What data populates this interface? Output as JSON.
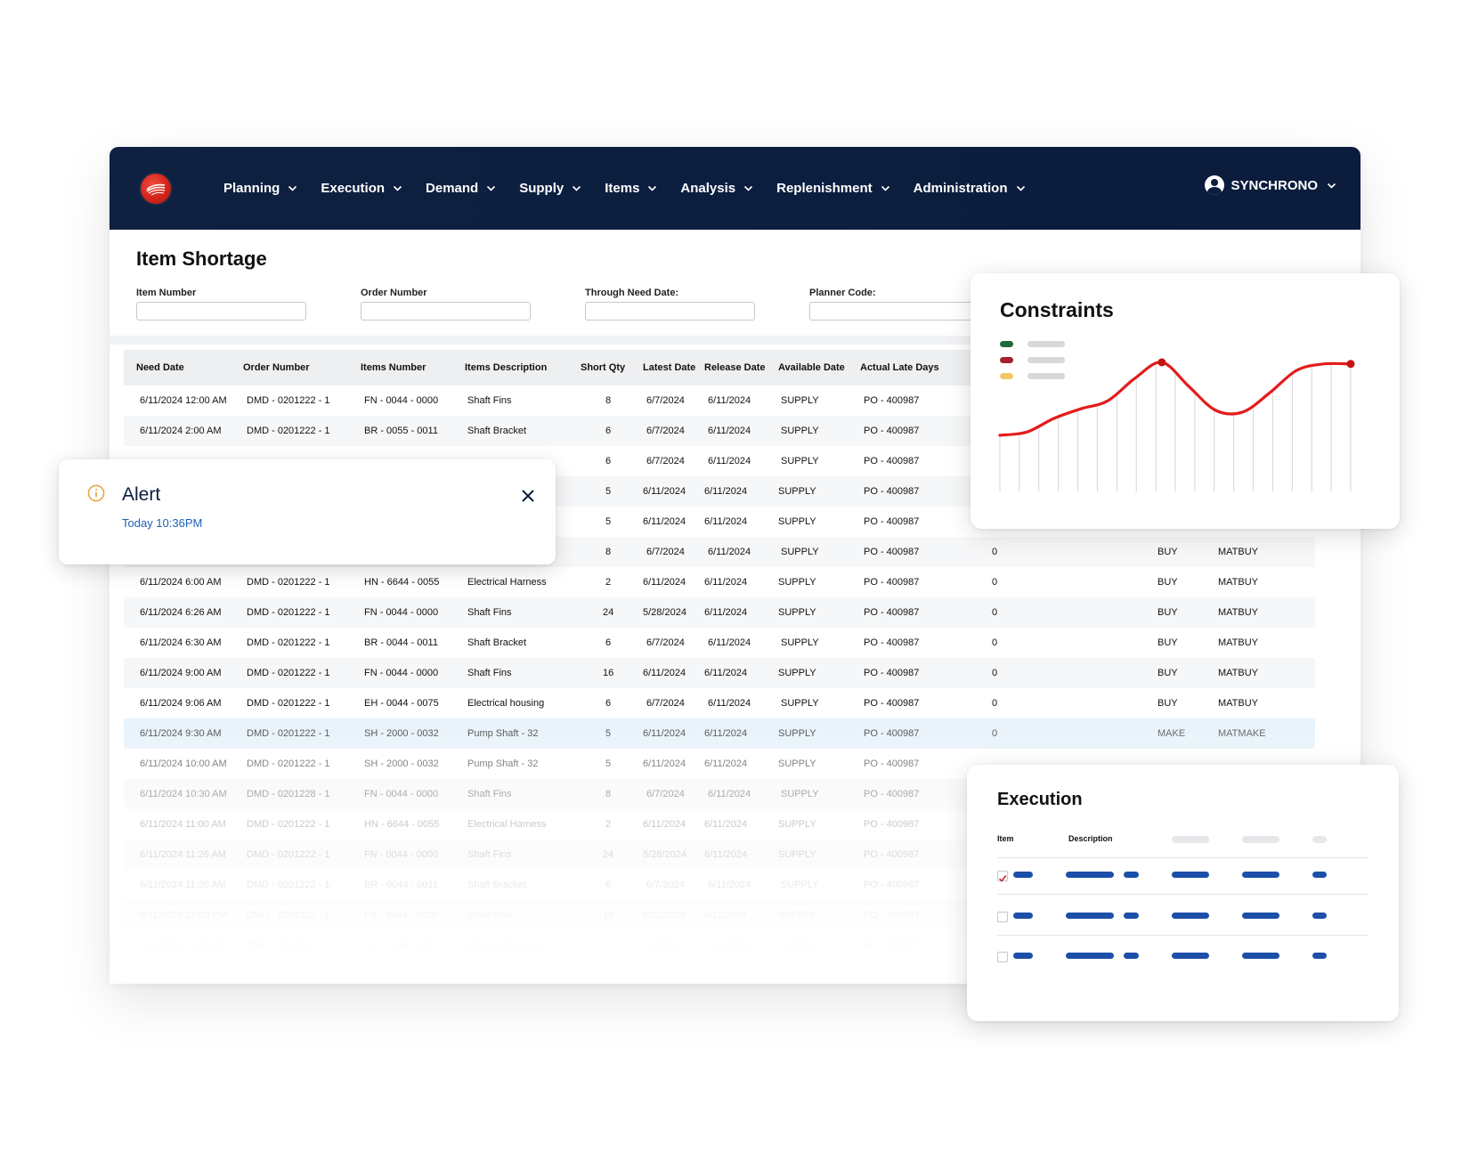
{
  "nav": {
    "items": [
      {
        "label": "Planning"
      },
      {
        "label": "Execution"
      },
      {
        "label": "Demand"
      },
      {
        "label": "Supply"
      },
      {
        "label": "Items"
      },
      {
        "label": "Analysis"
      },
      {
        "label": "Replenishment"
      },
      {
        "label": "Administration"
      }
    ],
    "user": "SYNCHRONO"
  },
  "page": {
    "title": "Item Shortage",
    "filters": [
      {
        "label": "Item Number",
        "value": ""
      },
      {
        "label": "Order Number",
        "value": ""
      },
      {
        "label": "Through Need Date:",
        "value": ""
      },
      {
        "label": "Planner Code:",
        "value": ""
      }
    ]
  },
  "table": {
    "columns": [
      "Need Date",
      "Order Number",
      "Items Number",
      "Items Description",
      "Short Qty",
      "Latest Date",
      "Release Date",
      "Available Date",
      "Actual Late Days"
    ],
    "rows": [
      [
        "6/11/2024 12:00 AM",
        "DMD - 0201222 - 1",
        "FN - 0044 - 0000",
        "Shaft Fins",
        "8",
        "6/7/2024",
        "6/11/2024",
        "SUPPLY",
        "PO - 400987",
        "",
        "",
        ""
      ],
      [
        "6/11/2024 2:00 AM",
        "DMD - 0201222 - 1",
        "BR - 0055 - 0011",
        "Shaft Bracket",
        "6",
        "6/7/2024",
        "6/11/2024",
        "SUPPLY",
        "PO - 400987",
        "",
        "",
        ""
      ],
      [
        "",
        "",
        "",
        "",
        "6",
        "6/7/2024",
        "6/11/2024",
        "SUPPLY",
        "PO - 400987",
        "",
        "",
        ""
      ],
      [
        "",
        "",
        "",
        "",
        "5",
        "6/11/2024",
        "6/11/2024",
        "SUPPLY",
        "PO - 400987",
        "",
        "",
        ""
      ],
      [
        "",
        "",
        "",
        "",
        "5",
        "6/11/2024",
        "6/11/2024",
        "SUPPLY",
        "PO - 400987",
        "",
        "",
        ""
      ],
      [
        "",
        "",
        "",
        "",
        "8",
        "6/7/2024",
        "6/11/2024",
        "SUPPLY",
        "PO - 400987",
        "0",
        "BUY",
        "MATBUY"
      ],
      [
        "6/11/2024 6:00 AM",
        "DMD - 0201222 - 1",
        "HN - 6644 - 0055",
        "Electrical Harness",
        "2",
        "6/11/2024",
        "6/11/2024",
        "SUPPLY",
        "PO - 400987",
        "0",
        "BUY",
        "MATBUY"
      ],
      [
        "6/11/2024 6:26 AM",
        "DMD - 0201222 - 1",
        "FN - 0044 - 0000",
        "Shaft Fins",
        "24",
        "5/28/2024",
        "6/11/2024",
        "SUPPLY",
        "PO - 400987",
        "0",
        "BUY",
        "MATBUY"
      ],
      [
        "6/11/2024 6:30 AM",
        "DMD - 0201222 - 1",
        "BR - 0044 - 0011",
        "Shaft Bracket",
        "6",
        "6/7/2024",
        "6/11/2024",
        "SUPPLY",
        "PO - 400987",
        "0",
        "BUY",
        "MATBUY"
      ],
      [
        "6/11/2024 9:00 AM",
        "DMD - 0201222 - 1",
        "FN - 0044 - 0000",
        "Shaft Fins",
        "16",
        "6/11/2024",
        "6/11/2024",
        "SUPPLY",
        "PO - 400987",
        "0",
        "BUY",
        "MATBUY"
      ],
      [
        "6/11/2024 9:06 AM",
        "DMD - 0201222 - 1",
        "EH - 0044 - 0075",
        "Electrical housing",
        "6",
        "6/7/2024",
        "6/11/2024",
        "SUPPLY",
        "PO - 400987",
        "0",
        "BUY",
        "MATBUY"
      ],
      [
        "6/11/2024 9:30 AM",
        "DMD - 0201222 - 1",
        "SH - 2000 - 0032",
        "Pump Shaft - 32",
        "5",
        "6/11/2024",
        "6/11/2024",
        "SUPPLY",
        "PO - 400987",
        "0",
        "MAKE",
        "MATMAKE"
      ],
      [
        "6/11/2024 10:00 AM",
        "DMD - 0201222 - 1",
        "SH - 2000 - 0032",
        "Pump Shaft - 32",
        "5",
        "6/11/2024",
        "6/11/2024",
        "SUPPLY",
        "PO - 400987",
        "",
        "",
        ""
      ],
      [
        "6/11/2024 10:30 AM",
        "DMD - 0201228 - 1",
        "FN - 0044 - 0000",
        "Shaft Fins",
        "8",
        "6/7/2024",
        "6/11/2024",
        "SUPPLY",
        "PO - 400987",
        "",
        "",
        ""
      ],
      [
        "6/11/2024 11:00 AM",
        "DMD - 0201222 - 1",
        "HN - 6644 - 0055",
        "Electrical Harness",
        "2",
        "6/11/2024",
        "6/11/2024",
        "SUPPLY",
        "PO - 400987",
        "",
        "",
        ""
      ],
      [
        "6/11/2024 11:26 AM",
        "DMD - 0201222 - 1",
        "FN - 0044 - 0000",
        "Shaft Fins",
        "24",
        "5/28/2024",
        "6/11/2024",
        "SUPPLY",
        "PO - 400987",
        "",
        "",
        ""
      ],
      [
        "6/11/2024 11:30 AM",
        "DMD - 0201222 - 1",
        "BR - 0044 - 0011",
        "Shaft Bracket",
        "6",
        "6/7/2024",
        "6/11/2024",
        "SUPPLY",
        "PO - 400987",
        "",
        "",
        ""
      ],
      [
        "6/11/2024 12:00 PM",
        "DMD - 0201222 - 1",
        "FN - 0044 - 0000",
        "Shaft Fins",
        "16",
        "6/11/2024",
        "6/11/2024",
        "SUPPLY",
        "PO - 400987",
        "",
        "",
        ""
      ],
      [
        "6/11/2024 12:06 PM",
        "DMD - 0201222 - 1",
        "EH - 0044 - 0075",
        "Electrical housing",
        "6",
        "6/7/2024",
        "6/11/2024",
        "SUPPLY",
        "PO - 400987",
        "",
        "",
        ""
      ]
    ],
    "selected_row": 11
  },
  "alert": {
    "title": "Alert",
    "time": "Today 10:36PM",
    "icon": "info-icon",
    "icon_color": "#e8a33c"
  },
  "constraints": {
    "title": "Constraints",
    "legend_colors": [
      "#1e6b35",
      "#a3232b",
      "#f2c867"
    ],
    "line_color": "#e31c1c",
    "y_values": [
      0.09,
      0.13,
      0.3,
      0.42,
      0.52,
      0.8,
      1.0,
      0.7,
      0.4,
      0.38,
      0.62,
      0.9,
      0.98,
      0.98
    ],
    "peak_points": [
      6,
      13
    ]
  },
  "execution": {
    "title": "Execution",
    "columns": [
      "Item",
      "Description"
    ],
    "rows": [
      {
        "checked": true
      },
      {
        "checked": false
      },
      {
        "checked": false
      }
    ],
    "accent": "#1c4fa8"
  }
}
